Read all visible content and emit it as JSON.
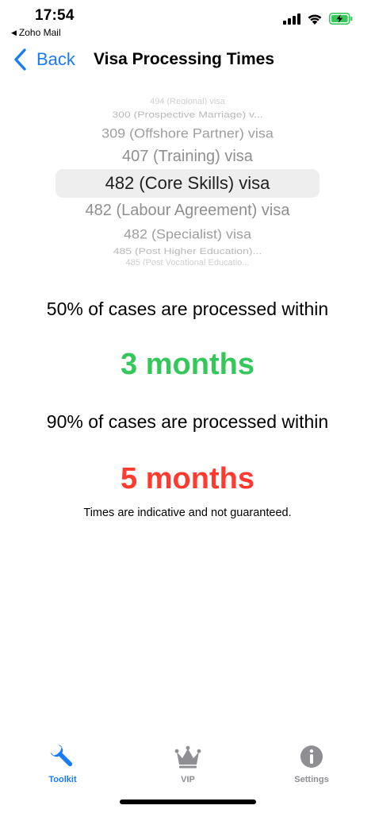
{
  "status_bar": {
    "time": "17:54",
    "back_app": "Zoho Mail",
    "back_icon": "triangle-left-icon",
    "icons": [
      "cellular-signal-icon",
      "wifi-icon",
      "battery-charging-icon"
    ]
  },
  "nav": {
    "back_label": "Back",
    "title": "Visa Processing Times"
  },
  "picker": {
    "items": [
      "494 (Regional) visa",
      "300 (Prospective Marriage) v...",
      "309 (Offshore Partner) visa",
      "407 (Training) visa",
      "482 (Core Skills) visa",
      "482 (Labour Agreement) visa",
      "482 (Specialist) visa",
      "485 (Post Higher Education)...",
      "485 (Post Vocational Educatio..."
    ],
    "selected": "482 (Core Skills) visa"
  },
  "results": {
    "label_50": "50% of cases are processed within",
    "value_50": "3 months",
    "label_90": "90% of cases are processed within",
    "value_90": "5 months",
    "disclaimer": "Times are indicative and not guaranteed."
  },
  "tabs": [
    {
      "label": "Toolkit",
      "icon": "wrench-icon",
      "active": true
    },
    {
      "label": "VIP",
      "icon": "crown-icon",
      "active": false
    },
    {
      "label": "Settings",
      "icon": "info-icon",
      "active": false
    }
  ],
  "colors": {
    "accent": "#1a7cf5",
    "green": "#34c759",
    "red": "#ff3b30",
    "inactive_tab": "#8e8e93",
    "battery": "#34c759"
  }
}
